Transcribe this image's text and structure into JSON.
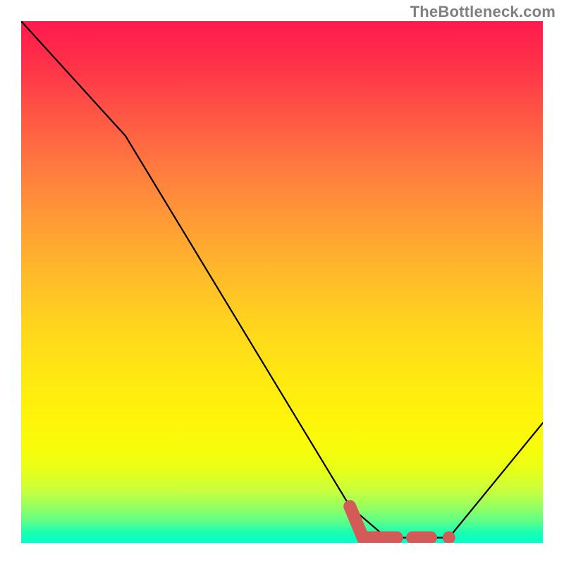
{
  "watermark": "TheBottleneck.com",
  "chart_data": {
    "type": "line",
    "title": "",
    "xlabel": "",
    "ylabel": "",
    "xlim": [
      0,
      100
    ],
    "ylim": [
      0,
      100
    ],
    "grid": false,
    "series": [
      {
        "name": "bottleneck-curve",
        "x": [
          0,
          20,
          63,
          70,
          78,
          82,
          100
        ],
        "y": [
          100,
          78,
          7,
          1,
          1,
          1,
          23
        ]
      }
    ],
    "markers": [
      {
        "name": "highlight-segment-1",
        "type": "thick-line",
        "points": [
          {
            "x": 63,
            "y": 7
          },
          {
            "x": 65.5,
            "y": 1
          },
          {
            "x": 72,
            "y": 1
          }
        ]
      },
      {
        "name": "highlight-segment-2",
        "type": "thick-line",
        "points": [
          {
            "x": 75,
            "y": 1
          },
          {
            "x": 78.5,
            "y": 1
          }
        ]
      },
      {
        "name": "highlight-dot",
        "type": "dot",
        "x": 82,
        "y": 1
      }
    ],
    "background_gradient": {
      "top_color": "#ff1a4d",
      "bottom_color": "#00ffcc"
    }
  }
}
